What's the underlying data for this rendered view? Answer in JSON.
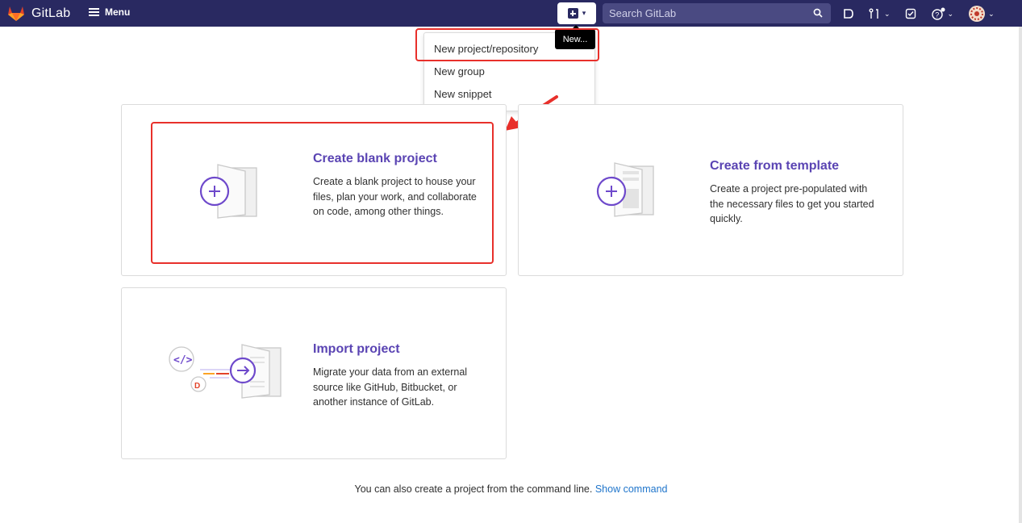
{
  "navbar": {
    "brand": "GitLab",
    "menu_label": "Menu",
    "search_placeholder": "Search GitLab",
    "new_tooltip": "New..."
  },
  "new_dropdown": {
    "items": [
      "New project/repository",
      "New group",
      "New snippet"
    ]
  },
  "cards": {
    "blank": {
      "title": "Create blank project",
      "description": "Create a blank project to house your files, plan your work, and collaborate on code, among other things."
    },
    "template": {
      "title": "Create from template",
      "description": "Create a project pre-populated with the necessary files to get you started quickly."
    },
    "import": {
      "title": "Import project",
      "description": "Migrate your data from an external source like GitHub, Bitbucket, or another instance of GitLab."
    }
  },
  "footer": {
    "text": "You can also create a project from the command line.",
    "link": "Show command"
  },
  "colors": {
    "navbar_bg": "#292961",
    "accent_purple": "#5a44b3",
    "highlight_red": "#e8302b",
    "link_blue": "#1f75cb"
  }
}
